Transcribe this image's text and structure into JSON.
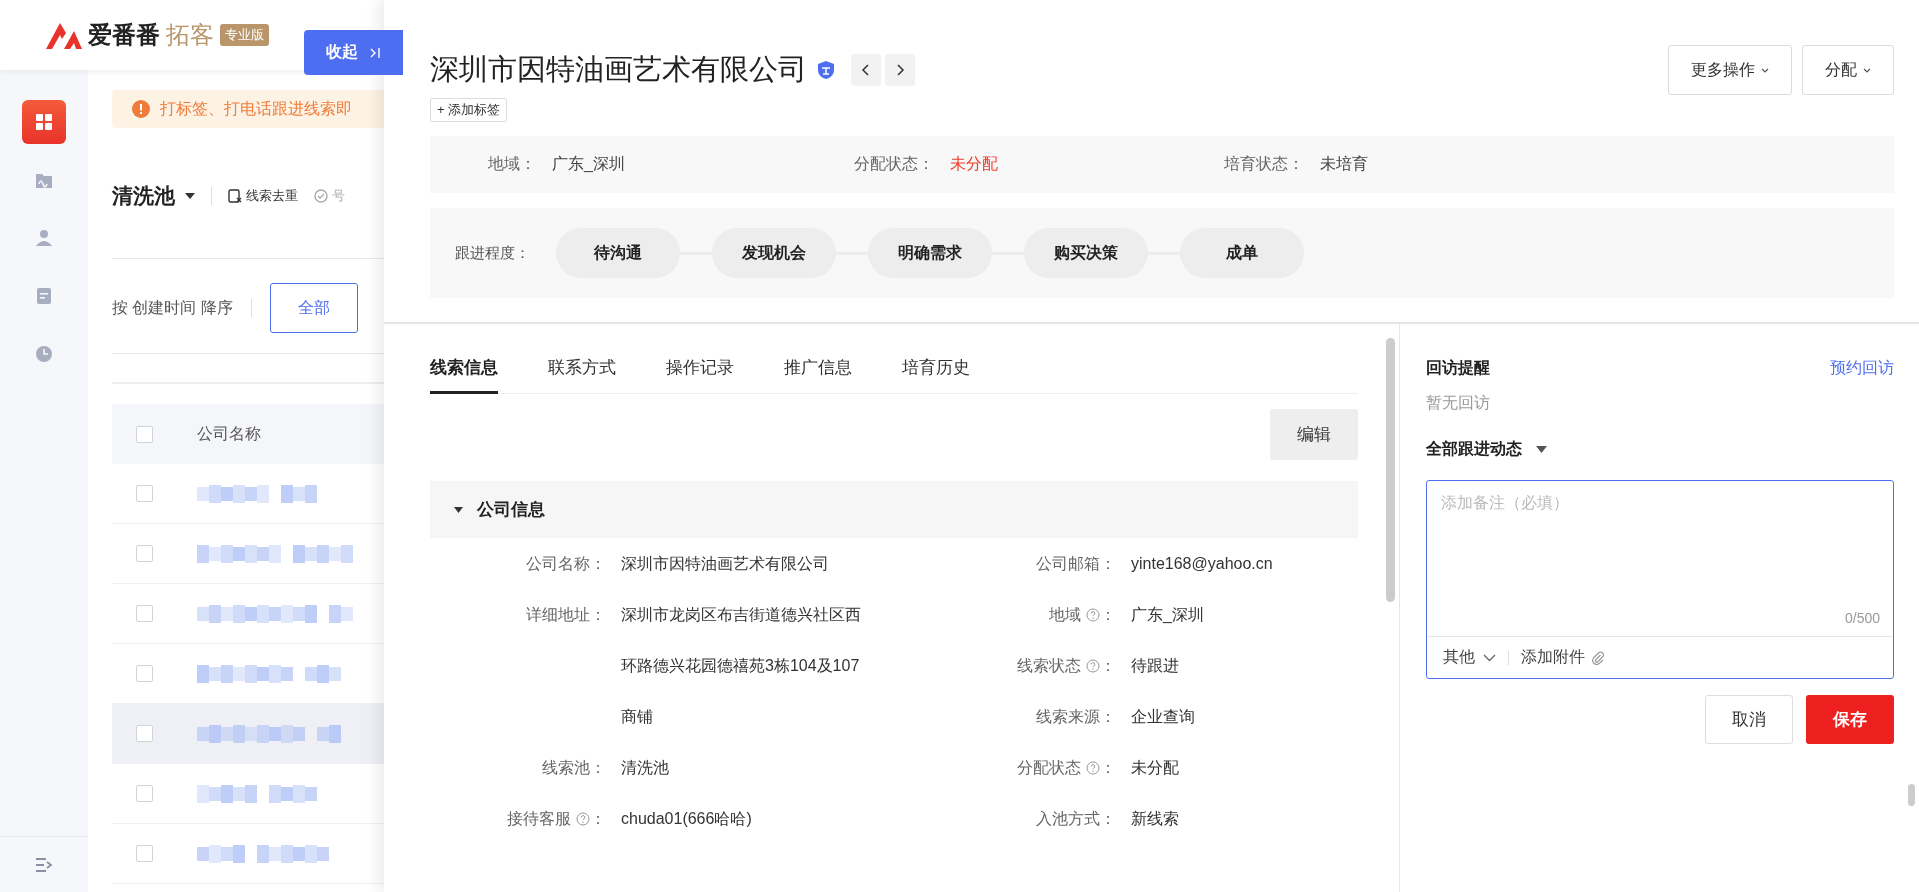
{
  "header": {
    "brand": "爱番番",
    "product": "拓客",
    "badge": "专业版"
  },
  "collapse_button": {
    "label": "收起"
  },
  "side_nav": {
    "items": [
      {
        "kind": "grid",
        "selected": true
      },
      {
        "kind": "folder",
        "selected": false
      },
      {
        "kind": "person",
        "selected": false
      },
      {
        "kind": "document",
        "selected": false
      },
      {
        "kind": "clock",
        "selected": false
      }
    ]
  },
  "notice": {
    "text": "打标签、打电话跟进线索即"
  },
  "pool": {
    "title": "清洗池",
    "actions": [
      {
        "label": "线索去重",
        "disabled": false
      },
      {
        "label": "号",
        "disabled": true
      }
    ]
  },
  "sort": {
    "text": "按 创建时间 降序",
    "filters": [
      {
        "label": "全部",
        "selected": true
      }
    ]
  },
  "table": {
    "select_all": {
      "checked": false
    },
    "columns": [
      "公司名称"
    ],
    "rows": [
      {
        "checked": false,
        "hovered": false
      },
      {
        "checked": false,
        "hovered": false
      },
      {
        "checked": false,
        "hovered": false
      },
      {
        "checked": false,
        "hovered": false
      },
      {
        "checked": false,
        "hovered": true
      },
      {
        "checked": false,
        "hovered": false
      },
      {
        "checked": false,
        "hovered": false
      }
    ]
  },
  "drawer": {
    "title": "深圳市因特油画艺术有限公司",
    "verified": true,
    "actions": [
      "更多操作",
      "分配"
    ],
    "add_tag": "+ 添加标签",
    "summary": [
      {
        "label": "地域：",
        "value": "广东_深圳",
        "alert": false
      },
      {
        "label": "分配状态：",
        "value": "未分配",
        "alert": true
      },
      {
        "label": "培育状态：",
        "value": "未培育",
        "alert": false
      }
    ],
    "progress": {
      "label": "跟进程度：",
      "stages": [
        "待沟通",
        "发现机会",
        "明确需求",
        "购买决策",
        "成单"
      ]
    },
    "tabs": [
      {
        "label": "线索信息",
        "selected": true
      },
      {
        "label": "联系方式",
        "selected": false
      },
      {
        "label": "操作记录",
        "selected": false
      },
      {
        "label": "推广信息",
        "selected": false
      },
      {
        "label": "培育历史",
        "selected": false
      }
    ],
    "edit_button": "编辑",
    "section": {
      "title": "公司信息",
      "expanded": true,
      "left": [
        {
          "label": "公司名称：",
          "value": "深圳市因特油画艺术有限公司",
          "help": false
        },
        {
          "label": "详细地址：",
          "value": "深圳市龙岗区布吉街道德兴社区西环路德兴花园德禧苑3栋104及107商铺",
          "help": false
        },
        {
          "label": "线索池：",
          "value": "清洗池",
          "help": false
        },
        {
          "label": "接待客服",
          "colon": "：",
          "value": "chuda01(666哈哈)",
          "help": true
        }
      ],
      "right": [
        {
          "label": "公司邮箱：",
          "value": "yinte168@yahoo.cn",
          "help": false
        },
        {
          "label": "地域",
          "colon": "：",
          "value": "广东_深圳",
          "help": true
        },
        {
          "label": "线索状态",
          "colon": "：",
          "value": "待跟进",
          "help": true
        },
        {
          "label": "线索来源：",
          "value": "企业查询",
          "help": false
        },
        {
          "label": "分配状态",
          "colon": "：",
          "value": "未分配",
          "help": true
        },
        {
          "label": "入池方式：",
          "value": "新线索",
          "help": false
        }
      ]
    }
  },
  "followup": {
    "reminder_title": "回访提醒",
    "reminder_link": "预约回访",
    "reminder_empty": "暂无回访",
    "feed_title": "全部跟进动态",
    "note": {
      "placeholder": "添加备注（必填）",
      "counter": "0/500",
      "type_select": "其他",
      "attach": "添加附件"
    },
    "buttons": [
      {
        "label": "取消",
        "kind": "secondary"
      },
      {
        "label": "保存",
        "kind": "primary"
      }
    ]
  }
}
